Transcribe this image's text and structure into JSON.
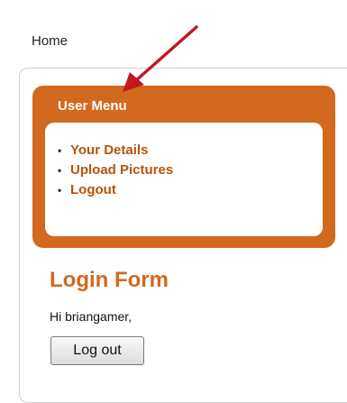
{
  "breadcrumb": {
    "home": "Home"
  },
  "user_menu": {
    "title": "User Menu",
    "items": [
      "Your Details",
      "Upload Pictures",
      "Logout"
    ]
  },
  "login_form": {
    "title": "Login Form",
    "greeting": "Hi briangamer,",
    "logout_button": "Log out"
  },
  "colors": {
    "accent": "#d2691e",
    "link": "#b5540c",
    "annotation_arrow": "#c0181f"
  },
  "icons": {
    "bullet": "•",
    "annotation": "red-arrow-icon"
  }
}
